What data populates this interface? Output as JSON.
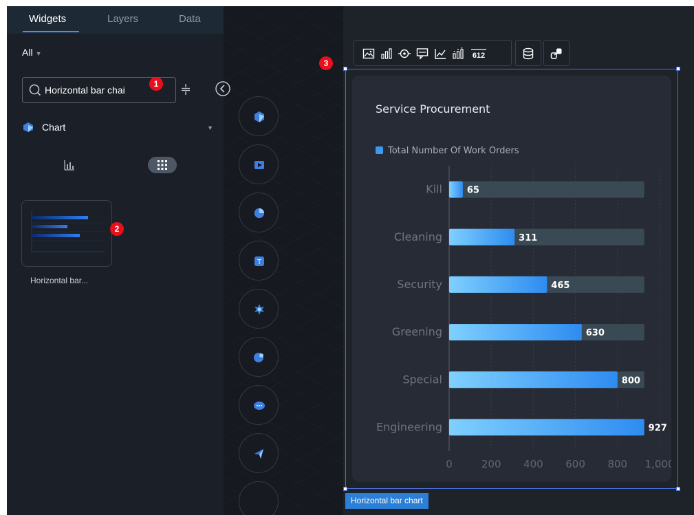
{
  "tabs": [
    {
      "label": "Widgets",
      "active": true
    },
    {
      "label": "Layers",
      "active": false
    },
    {
      "label": "Data",
      "active": false
    }
  ],
  "filter": {
    "label": "All"
  },
  "search": {
    "value": "Horizontal bar chai"
  },
  "category": {
    "label": "Chart",
    "icon": "chart-category-icon"
  },
  "view_modes": [
    "bar-list-icon",
    "grid-icon"
  ],
  "widget_card": {
    "label": "Horizontal bar...",
    "preview": "horizontal-bar-chart-thumbnail"
  },
  "badges": [
    "1",
    "2",
    "3"
  ],
  "tool_icons": [
    "component-tool-1-icon",
    "component-tool-2-icon",
    "component-tool-3-icon",
    "component-tool-4-icon",
    "component-tool-5-icon",
    "component-tool-6-icon",
    "component-tool-7-icon",
    "component-tool-8-icon"
  ],
  "toolbar": [
    "image-icon",
    "bar-chart-icon",
    "target-icon",
    "comment-icon",
    "line-chart-icon",
    "bar-values-icon",
    "number-612-icon",
    "database-icon",
    "link-icon"
  ],
  "toolbar_number_glyph": "612",
  "selection_label": "Horizontal bar chart",
  "colors": {
    "accent": "#4a8ff0",
    "badge": "#e8101d",
    "bar_start": "#7fd0ff",
    "bar_end": "#2e8cf0",
    "track": "#3a4a54",
    "selection": "#4a6fd8"
  },
  "chart_data": {
    "type": "bar",
    "orientation": "horizontal",
    "title": "Service Procurement",
    "legend": {
      "label": "Total Number Of Work Orders",
      "position": "top-left"
    },
    "categories": [
      "Kill",
      "Cleaning",
      "Security",
      "Greening",
      "Special",
      "Engineering"
    ],
    "series": [
      {
        "name": "Total Number Of Work Orders",
        "values": [
          65,
          311,
          465,
          630,
          800,
          927
        ]
      }
    ],
    "background_value": 927,
    "xlim": [
      0,
      1000
    ],
    "xticks": [
      "0",
      "200",
      "400",
      "600",
      "800",
      "1,000"
    ],
    "grid": true
  }
}
